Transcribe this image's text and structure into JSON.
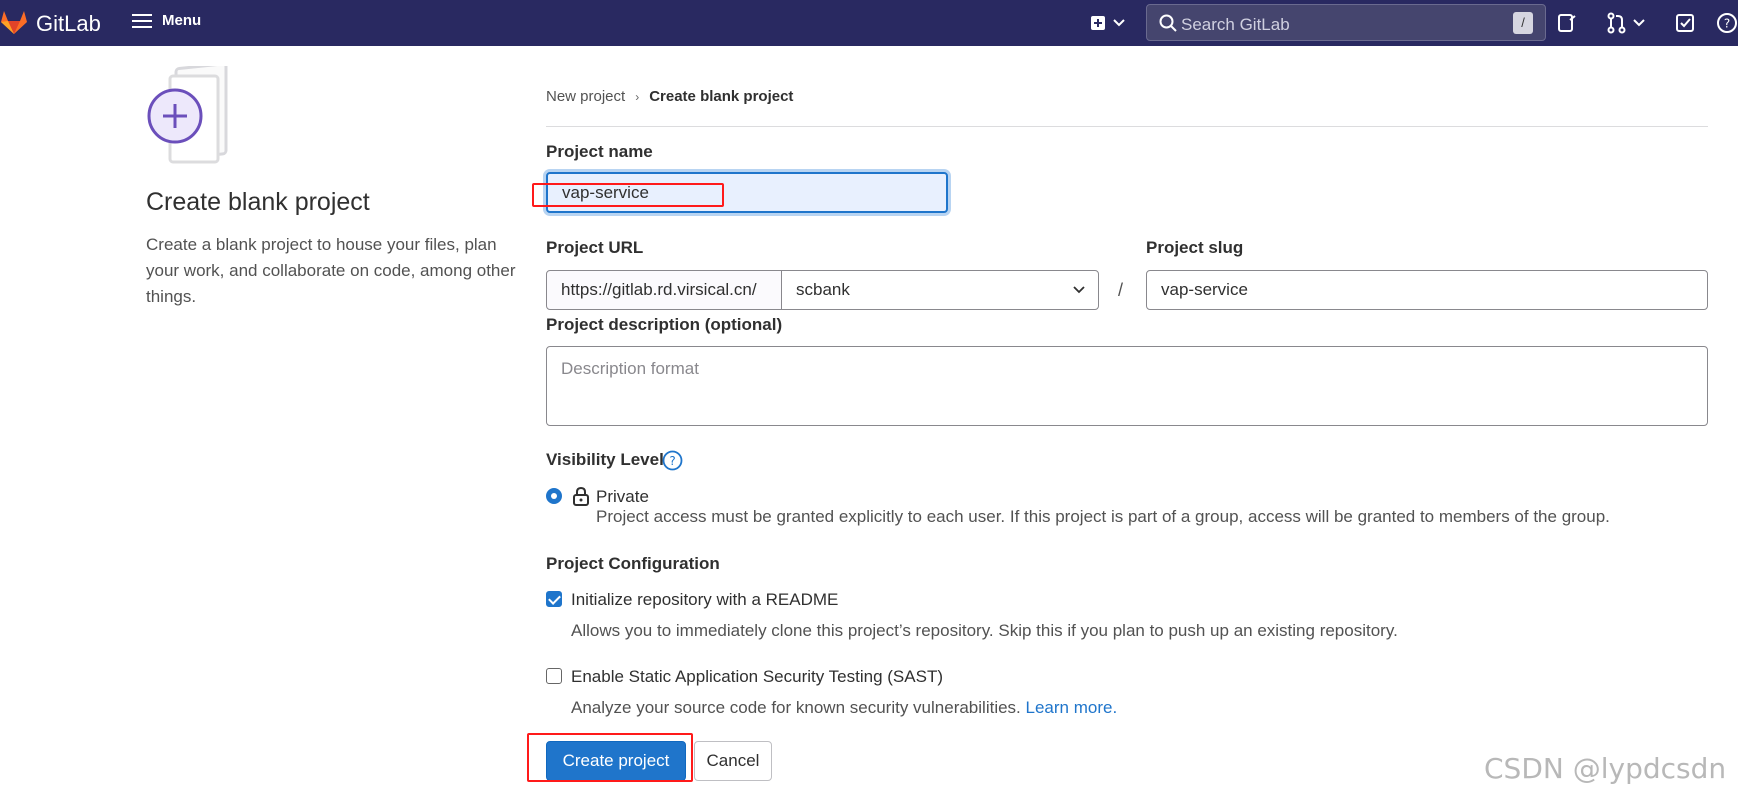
{
  "topbar": {
    "brand": "GitLab",
    "menu_label": "Menu",
    "search_placeholder": "Search GitLab",
    "search_shortcut": "/",
    "background": "#292961"
  },
  "left": {
    "title": "Create blank project",
    "description": "Create a blank project to house your files, plan your work, and collaborate on code, among other things."
  },
  "breadcrumb": {
    "items": [
      "New project",
      "Create blank project"
    ]
  },
  "form": {
    "project_name_label": "Project name",
    "project_name_value": "vap-service",
    "project_url_label": "Project URL",
    "project_url_prefix": "https://gitlab.rd.virsical.cn/",
    "namespace_value": "scbank",
    "url_separator": "/",
    "project_slug_label": "Project slug",
    "project_slug_value": "vap-service",
    "description_label": "Project description (optional)",
    "description_placeholder": "Description format",
    "visibility_label": "Visibility Level",
    "visibility_option": "Private",
    "visibility_help": "Project access must be granted explicitly to each user. If this project is part of a group, access will be granted to members of the group.",
    "config_label": "Project Configuration",
    "readme_label": "Initialize repository with a README",
    "readme_checked": true,
    "readme_help": "Allows you to immediately clone this project’s repository. Skip this if you plan to push up an existing repository.",
    "sast_label": "Enable Static Application Security Testing (SAST)",
    "sast_checked": false,
    "sast_help": "Analyze your source code for known security vulnerabilities.",
    "learn_more": "Learn more.",
    "create_button": "Create project",
    "cancel_button": "Cancel"
  },
  "watermark": "CSDN @lypdcsdn",
  "colors": {
    "accent": "#1f75cb",
    "highlight": "#ff1a1a"
  }
}
